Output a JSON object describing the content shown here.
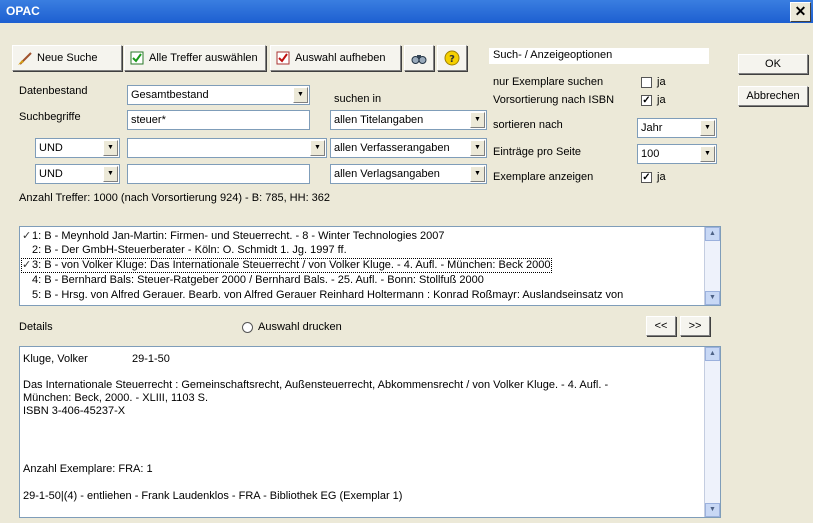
{
  "window": {
    "title": "OPAC",
    "close_glyph": "✕"
  },
  "toolbar": {
    "new_search": "Neue Suche",
    "select_all": "Alle Treffer auswählen",
    "clear_selection": "Auswahl aufheben",
    "binoculars_icon": "binoculars-icon",
    "help_icon": "help-icon"
  },
  "dialog": {
    "ok": "OK",
    "cancel": "Abbrechen"
  },
  "search": {
    "database_label": "Datenbestand",
    "database_value": "Gesamtbestand",
    "terms_label": "Suchbegriffe",
    "term1": "steuer*",
    "search_in_label": "suchen in",
    "scope1": "allen Titelangaben",
    "op2": "UND",
    "term2": "",
    "scope2": "allen Verfasserangaben",
    "op3": "UND",
    "term3": "",
    "scope3": "allen Verlagsangaben"
  },
  "options": {
    "header": "Such- / Anzeigeoptionen",
    "only_copies_label": "nur Exemplare suchen",
    "only_copies_checked": false,
    "only_copies_text": "ja",
    "presort_isbn_label": "Vorsortierung nach ISBN",
    "presort_isbn_checked": true,
    "presort_isbn_text": "ja",
    "sort_label": "sortieren nach",
    "sort_value": "Jahr",
    "per_page_label": "Einträge pro Seite",
    "per_page_value": "100",
    "show_copies_label": "Exemplare anzeigen",
    "show_copies_checked": true,
    "show_copies_text": "ja"
  },
  "hits": {
    "summary": "Anzahl Treffer: 1000 (nach Vorsortierung 924) - B: 785, HH: 362"
  },
  "results": [
    {
      "checked": true,
      "text": "1: B - Meynhold Jan-Martin: Firmen- und Steuerrecht. - 8 - Winter Technologies 2007",
      "selected": false
    },
    {
      "checked": false,
      "text": "2: B - Der GmbH-Steuerberater - Köln: O. Schmidt 1. Jg. 1997 ff.",
      "selected": false
    },
    {
      "checked": true,
      "text": "3: B - von Volker Kluge: Das Internationale Steuerrecht / von Volker Kluge. - 4. Aufl. - München: Beck 2000",
      "selected": true
    },
    {
      "checked": false,
      "text": "4: B - Bernhard Bals: Steuer-Ratgeber 2000 / Bernhard Bals. - 25. Aufl. - Bonn: Stollfuß 2000",
      "selected": false
    },
    {
      "checked": false,
      "text": "5: B - Hrsg. von Alfred Gerauer. Bearb. von Alfred Gerauer  Reinhard Holtermann : Konrad Roßmayr: Auslandseinsatz von",
      "selected": false
    }
  ],
  "details": {
    "label": "Details",
    "print_selection": "Auswahl drucken",
    "prev": "<<",
    "next": ">>",
    "author": "Kluge, Volker",
    "signature": "29-1-50",
    "title_line1": "Das Internationale Steuerrecht : Gemeinschaftsrecht, Außensteuerrecht, Abkommensrecht / von Volker Kluge. - 4. Aufl. -",
    "title_line2": "München: Beck, 2000. - XLIII, 1103 S.",
    "isbn": "ISBN 3-406-45237-X",
    "copies_count": "Anzahl Exemplare:  FRA: 1",
    "copy_status": "29-1-50|(4) - entliehen - Frank Laudenklos - FRA - Bibliothek EG (Exemplar 1)"
  }
}
